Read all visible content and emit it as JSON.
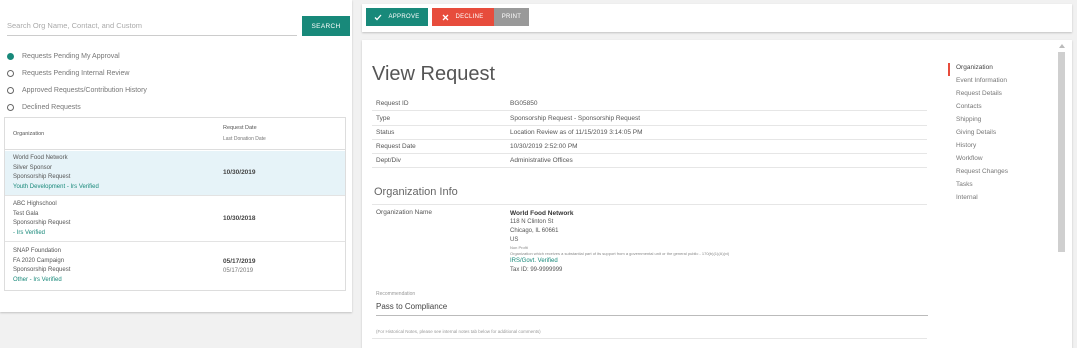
{
  "search": {
    "placeholder": "Search Org Name, Contact, and Custom",
    "button": "SEARCH"
  },
  "filters": [
    {
      "label": "Requests Pending My Approval",
      "selected": true
    },
    {
      "label": "Requests Pending Internal Review",
      "selected": false
    },
    {
      "label": "Approved Requests/Contribution History",
      "selected": false
    },
    {
      "label": "Declined Requests",
      "selected": false
    }
  ],
  "request_table": {
    "headers": {
      "organization": "Organization",
      "request_date": "Request Date",
      "last_donation_date": "Last Donation Date"
    },
    "rows": [
      {
        "lines": [
          "World Food Network",
          "Silver Sponsor",
          "Sponsorship Request"
        ],
        "status": "Youth Development - Irs Verified",
        "date": "10/30/2019",
        "last": "",
        "selected": true
      },
      {
        "lines": [
          "ABC Highschool",
          "Test Gala",
          "Sponsorship Request"
        ],
        "status": "- Irs Verified",
        "date": "10/30/2018",
        "last": "",
        "selected": false
      },
      {
        "lines": [
          "SNAP Foundation",
          "FA 2020 Campaign",
          "Sponsorship Request"
        ],
        "status": "Other - Irs Verified",
        "date": "05/17/2019",
        "last": "05/17/2019",
        "selected": false
      }
    ]
  },
  "toolbar": {
    "approve": "APPROVE",
    "decline": "DECLINE",
    "print": "PRINT"
  },
  "view": {
    "title": "View Request",
    "details": [
      {
        "key": "Request ID",
        "value": "BG05850"
      },
      {
        "key": "Type",
        "value": "Sponsorship Request - Sponsorship Request"
      },
      {
        "key": "Status",
        "value": "Location Review as of 11/15/2019 3:14:05 PM"
      },
      {
        "key": "Request Date",
        "value": "10/30/2019 2:52:00 PM"
      },
      {
        "key": "Dept/Div",
        "value": "Administrative Offices"
      }
    ],
    "org_info_title": "Organization Info",
    "org_name_label": "Organization Name",
    "org": {
      "name": "World Food Network",
      "street": "118 N Clinton St",
      "city": "Chicago, IL 60661",
      "country": "US",
      "type": "Non Profit",
      "description": "Organization which receives a substantial part of its support from a governmental unit or the general public - 170(b)(1)(A)(vi)",
      "verified": "IRS/Govt. Verified",
      "tax_id": "Tax ID: 99-9999999"
    },
    "recommendation_label": "Recommendation",
    "recommendation_value": "Pass to Compliance",
    "notes": "(For Historical Notes, please see internal notes tab below for additional comments)"
  },
  "side_nav": [
    {
      "label": "Organization",
      "active": true
    },
    {
      "label": "Event Information",
      "active": false
    },
    {
      "label": "Request Details",
      "active": false
    },
    {
      "label": "Contacts",
      "active": false
    },
    {
      "label": "Shipping",
      "active": false
    },
    {
      "label": "Giving Details",
      "active": false
    },
    {
      "label": "History",
      "active": false
    },
    {
      "label": "Workflow",
      "active": false
    },
    {
      "label": "Request Changes",
      "active": false
    },
    {
      "label": "Tasks",
      "active": false
    },
    {
      "label": "Internal",
      "active": false
    }
  ],
  "colors": {
    "accent": "#18897a",
    "decline": "#e74c3c",
    "print": "#999999",
    "selected_row": "#e6f3f8"
  }
}
